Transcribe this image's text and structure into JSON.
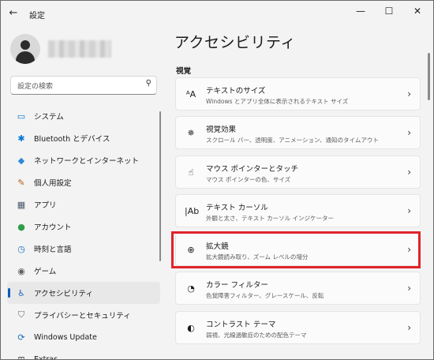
{
  "window": {
    "title": "設定",
    "back": "←",
    "minimize": "—",
    "maximize": "☐",
    "close": "✕"
  },
  "search": {
    "placeholder": "設定の検索"
  },
  "sidebar": {
    "items": [
      {
        "label": "システム",
        "icon": "monitor-icon",
        "glyph": "▭",
        "color": "#0078d4"
      },
      {
        "label": "Bluetooth とデバイス",
        "icon": "bluetooth-icon",
        "glyph": "✱",
        "color": "#0078d4"
      },
      {
        "label": "ネットワークとインターネット",
        "icon": "wifi-icon",
        "glyph": "◆",
        "color": "#2b88d8"
      },
      {
        "label": "個人用設定",
        "icon": "brush-icon",
        "glyph": "✎",
        "color": "#b35f14"
      },
      {
        "label": "アプリ",
        "icon": "apps-icon",
        "glyph": "▦",
        "color": "#4a5a6a"
      },
      {
        "label": "アカウント",
        "icon": "account-icon",
        "glyph": "●",
        "color": "#2e9e48"
      },
      {
        "label": "時刻と言語",
        "icon": "globe-clock-icon",
        "glyph": "◷",
        "color": "#1c6fb5"
      },
      {
        "label": "ゲーム",
        "icon": "gamepad-icon",
        "glyph": "◉",
        "color": "#5e5e5e"
      },
      {
        "label": "アクセシビリティ",
        "icon": "accessibility-icon",
        "glyph": "♿",
        "color": "#1f66c2",
        "active": true
      },
      {
        "label": "プライバシーとセキュリティ",
        "icon": "shield-icon",
        "glyph": "⛉",
        "color": "#6b6b6b"
      },
      {
        "label": "Windows Update",
        "icon": "update-icon",
        "glyph": "⟳",
        "color": "#1c6fb5"
      },
      {
        "label": "Extras",
        "icon": "extras-icon",
        "glyph": "⊞",
        "color": "#444444"
      }
    ]
  },
  "main": {
    "title": "アクセシビリティ",
    "section": "視覚",
    "cards": [
      {
        "title": "テキストのサイズ",
        "subtitle": "Windows とアプリ全体に表示されるテキスト サイズ",
        "icon": "text-size-icon",
        "glyph": "ᴬA"
      },
      {
        "title": "視覚効果",
        "subtitle": "スクロール バー、透明度、アニメーション、通知のタイムアウト",
        "icon": "sparkle-icon",
        "glyph": "✵"
      },
      {
        "title": "マウス ポインターとタッチ",
        "subtitle": "マウス ポインターの色、サイズ",
        "icon": "pointer-icon",
        "glyph": "☝"
      },
      {
        "title": "テキスト カーソル",
        "subtitle": "外観と太さ、テキスト カーソル インジケーター",
        "icon": "text-cursor-icon",
        "glyph": "|Ab"
      },
      {
        "title": "拡大鏡",
        "subtitle": "拡大鏡読み取り、ズーム レベルの増分",
        "icon": "magnifier-icon",
        "glyph": "⊕",
        "highlighted": true
      },
      {
        "title": "カラー フィルター",
        "subtitle": "色覚障害フィルター、グレースケール、反転",
        "icon": "palette-icon",
        "glyph": "◔"
      },
      {
        "title": "コントラスト テーマ",
        "subtitle": "弱視、光線過敏症のための配色テーマ",
        "icon": "contrast-icon",
        "glyph": "◐"
      }
    ],
    "chevron": "›"
  },
  "colors": {
    "accent": "#005fb8",
    "highlight": "#e0242a"
  }
}
